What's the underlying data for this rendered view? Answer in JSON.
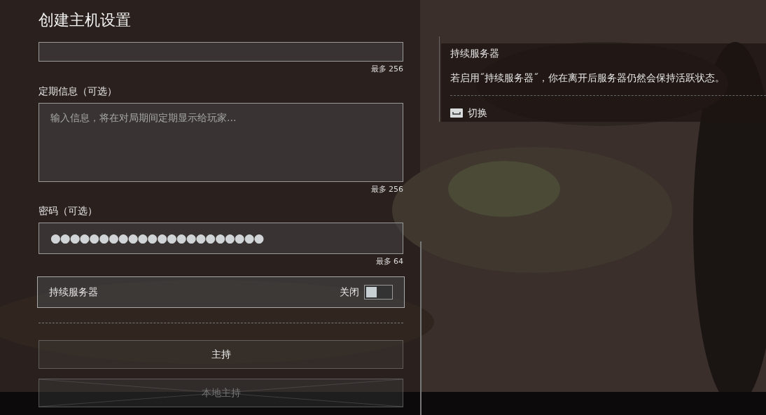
{
  "title": "创建主机设置",
  "fields": [
    {
      "kind": "input",
      "counter": "最多 256"
    },
    {
      "kind": "textarea",
      "label": "定期信息（可选）",
      "placeholder": "输入信息，将在对局期间定期显示给玩家...",
      "counter": "最多 256"
    },
    {
      "kind": "password",
      "label": "密码（可选）",
      "value": "●●●●●●●●●●●●●●●●●●●●●●",
      "counter": "最多 64"
    }
  ],
  "toggle": {
    "label": "持续服务器",
    "state_text": "关闭",
    "on": false
  },
  "buttons": [
    {
      "label": "主持",
      "disabled": false
    },
    {
      "label": "本地主持",
      "disabled": true
    }
  ],
  "info_panel": {
    "title": "持续服务器",
    "text": "若启用˝持续服务器˝，你在离开后服务器仍然会保持活跃状态。",
    "action": "切换"
  }
}
